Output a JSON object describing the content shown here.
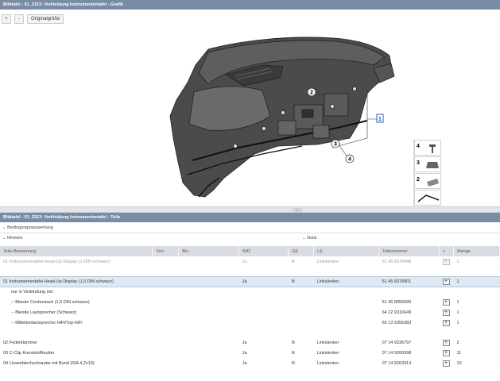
{
  "graphic_panel": {
    "title": "Bildtafel - 51_2313: Verkleidung Instrumententafel - Grafik",
    "zoom_in_label": "+",
    "zoom_out_label": "-",
    "original_size_label": "Originalgröße",
    "callouts": [
      "1",
      "2",
      "3",
      "4"
    ],
    "thumbnails": [
      "4",
      "3",
      "2",
      ""
    ]
  },
  "parts_panel": {
    "title": "Bildtafel - 51_2313: Verkleidung Instrumententafel - Teile",
    "collapse_arrow": "⌄",
    "filter_conditions": "Bedingungsauswertung",
    "filter_hint": "Hinweis",
    "filter_note": "Notiz",
    "columns": [
      "Teile-Benennung",
      "Von",
      "Bis",
      "KAT",
      "GE",
      "LE",
      "Teilenummer",
      "+",
      "Menge"
    ],
    "rows": [
      {
        "name": "01 Instrumententafel Head-Up Display (1 DIN schwarz)",
        "von": "",
        "bis": "",
        "kat": "Ja",
        "ge": "N",
        "le": "Linkslenker",
        "part": "51 45 8378448",
        "plus": "+",
        "qty": "1",
        "style": "grey"
      },
      {
        "name": "",
        "von": "",
        "bis": "",
        "kat": "",
        "ge": "",
        "le": "",
        "part": "",
        "plus": "",
        "qty": "",
        "style": "spacer"
      },
      {
        "name": "01 Instrumententafel Head-Up Display (1,5 DIN schwarz)",
        "von": "",
        "bis": "",
        "kat": "Ja",
        "ge": "N",
        "le": "Linkslenker",
        "part": "51 45 8378901",
        "plus": "+",
        "qty": "1",
        "style": "selected"
      },
      {
        "name": "nur in Verbindung mit:",
        "von": "",
        "bis": "",
        "kat": "",
        "ge": "",
        "le": "",
        "part": "",
        "plus": "",
        "qty": "",
        "style": "sub"
      },
      {
        "name": "-- Blende Centerstack (1,5 DIN schwarz)",
        "von": "",
        "bis": "",
        "kat": "",
        "ge": "",
        "le": "",
        "part": "51 45 8056990",
        "plus": "+",
        "qty": "1",
        "style": "sub"
      },
      {
        "name": "-- Blende Lautsprecher (Schwarz)",
        "von": "",
        "bis": "",
        "kat": "",
        "ge": "",
        "le": "",
        "part": "64 22 9316649",
        "plus": "+",
        "qty": "1",
        "style": "sub"
      },
      {
        "name": "-- Mitteltonlautsprecher HiFi/Top-HiFi",
        "von": "",
        "bis": "",
        "kat": "",
        "ge": "",
        "le": "",
        "part": "65 13 9356383",
        "plus": "+",
        "qty": "1",
        "style": "sub"
      },
      {
        "name": "",
        "von": "",
        "bis": "",
        "kat": "",
        "ge": "",
        "le": "",
        "part": "",
        "plus": "",
        "qty": "",
        "style": "spacer"
      },
      {
        "name": "02 Federklammer",
        "von": "",
        "bis": "",
        "kat": "Ja",
        "ge": "N",
        "le": "Linkslenker",
        "part": "07 14 9236797",
        "plus": "+",
        "qty": "2",
        "style": "normal"
      },
      {
        "name": "03 C-Clip Kunststoffmutter",
        "von": "",
        "bis": "",
        "kat": "Ja",
        "ge": "N",
        "le": "Linkslenker",
        "part": "07 14 9200998",
        "plus": "+",
        "qty": "11",
        "style": "normal"
      },
      {
        "name": "04 Linsenblechschraube mit Bund (ISA 4,2x19)",
        "von": "",
        "bis": "",
        "kat": "Ja",
        "ge": "N",
        "le": "Linkslenker",
        "part": "07 14 8263913",
        "plus": "+",
        "qty": "10",
        "style": "normal"
      }
    ]
  },
  "colors": {
    "titlebar": "#7a8ba4",
    "header_row": "#d9dde2",
    "selected_row": "#dfe8f3"
  }
}
